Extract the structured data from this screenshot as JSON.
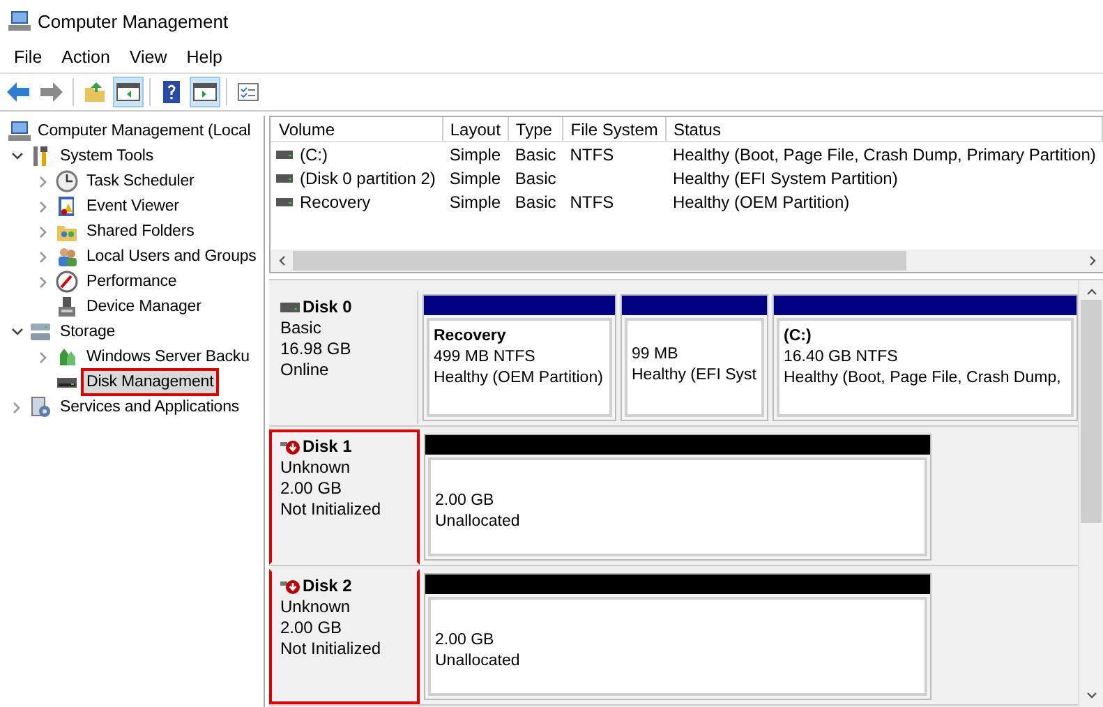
{
  "window": {
    "title": "Computer Management"
  },
  "menu": [
    "File",
    "Action",
    "View",
    "Help"
  ],
  "toolbar": [
    {
      "kind": "button",
      "pressed": false
    },
    {
      "kind": "button",
      "pressed": false
    },
    {
      "kind": "separator"
    },
    {
      "kind": "button",
      "pressed": false
    },
    {
      "kind": "button",
      "pressed": true
    },
    {
      "kind": "separator"
    },
    {
      "kind": "button",
      "pressed": false
    },
    {
      "kind": "button",
      "pressed": true
    },
    {
      "kind": "separator"
    },
    {
      "kind": "button",
      "pressed": false
    }
  ],
  "tree": [
    {
      "label": "Computer Management (Local",
      "selected": false,
      "highlighted": false,
      "children": [
        {
          "label": "System Tools",
          "expanded": true,
          "selected": false,
          "highlighted": false,
          "children": [
            {
              "label": "Task Scheduler",
              "expanded": false,
              "selected": false,
              "highlighted": false
            },
            {
              "label": "Event Viewer",
              "expanded": false,
              "selected": false,
              "highlighted": false
            },
            {
              "label": "Shared Folders",
              "expanded": false,
              "selected": false,
              "highlighted": false
            },
            {
              "label": "Local Users and Groups",
              "expanded": false,
              "selected": false,
              "highlighted": false
            },
            {
              "label": "Performance",
              "expanded": false,
              "selected": false,
              "highlighted": false
            },
            {
              "label": "Device Manager",
              "selected": false,
              "highlighted": false
            }
          ]
        },
        {
          "label": "Storage",
          "expanded": true,
          "selected": false,
          "highlighted": false,
          "children": [
            {
              "label": "Windows Server Backu",
              "expanded": false,
              "selected": false,
              "highlighted": false
            },
            {
              "label": "Disk Management",
              "selected": true,
              "highlighted": true
            }
          ]
        },
        {
          "label": "Services and Applications",
          "expanded": false,
          "selected": false,
          "highlighted": false
        }
      ]
    }
  ],
  "volume_table": {
    "columns": [
      "Volume",
      "Layout",
      "Type",
      "File System",
      "Status"
    ],
    "rows": [
      [
        "(C:)",
        "Simple",
        "Basic",
        "NTFS",
        "Healthy (Boot, Page File, Crash Dump, Primary Partition)"
      ],
      [
        "(Disk 0 partition 2)",
        "Simple",
        "Basic",
        "",
        "Healthy (EFI System Partition)"
      ],
      [
        "Recovery",
        "Simple",
        "Basic",
        "NTFS",
        "Healthy (OEM Partition)"
      ]
    ]
  },
  "disks": [
    {
      "name": "Disk 0",
      "kind": "online",
      "type": "Basic",
      "size": "16.98 GB",
      "state": "Online",
      "highlighted": false,
      "partitions": [
        {
          "name": "Recovery",
          "size": "499 MB NTFS",
          "status": "Healthy (OEM Partition)",
          "color": "#000080"
        },
        {
          "size": "99 MB",
          "status": "Healthy (EFI Syst",
          "color": "#000080"
        },
        {
          "name": "(C:)",
          "size": "16.40 GB NTFS",
          "status": "Healthy (Boot, Page File, Crash Dump,",
          "color": "#000080"
        }
      ]
    },
    {
      "name": "Disk 1",
      "kind": "error",
      "type": "Unknown",
      "size": "2.00 GB",
      "state": "Not Initialized",
      "highlighted": true,
      "partitions": [
        {
          "size": "2.00 GB",
          "status": "Unallocated",
          "color": "#000000"
        }
      ]
    },
    {
      "name": "Disk 2",
      "kind": "error",
      "type": "Unknown",
      "size": "2.00 GB",
      "state": "Not Initialized",
      "highlighted": true,
      "partitions": [
        {
          "size": "2.00 GB",
          "status": "Unallocated",
          "color": "#000000"
        }
      ]
    }
  ]
}
